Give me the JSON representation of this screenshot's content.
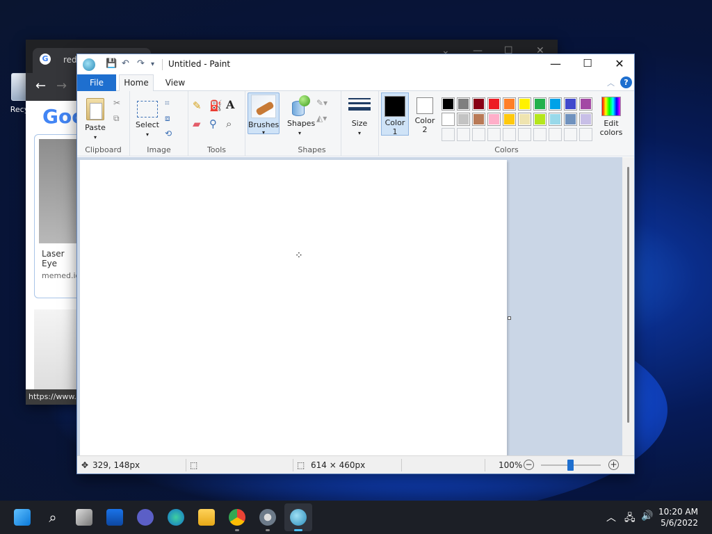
{
  "desktop": {
    "recycle_label": "Recyc"
  },
  "chrome": {
    "tab_title": "red ey",
    "google_text": "Goo",
    "card_title": "Laser Eye",
    "card_url": "memed.io",
    "status_url": "https://www."
  },
  "paint": {
    "title": "Untitled - Paint",
    "tabs": {
      "file": "File",
      "home": "Home",
      "view": "View"
    },
    "help": "?",
    "groups": {
      "clipboard": "Clipboard",
      "image": "Image",
      "tools": "Tools",
      "shapes": "Shapes",
      "colors": "Colors"
    },
    "buttons": {
      "paste": "Paste",
      "select": "Select",
      "brushes": "Brushes",
      "shapes": "Shapes",
      "size": "Size",
      "color1_a": "Color",
      "color1_b": "1",
      "color2_a": "Color",
      "color2_b": "2",
      "edit_colors_a": "Edit",
      "edit_colors_b": "colors"
    },
    "color1": "#000000",
    "color2": "#ffffff",
    "palette_row1": [
      "#000000",
      "#7f7f7f",
      "#880015",
      "#ed1c24",
      "#ff7f27",
      "#fff200",
      "#22b14c",
      "#00a2e8",
      "#3f48cc",
      "#a349a4"
    ],
    "palette_row2": [
      "#ffffff",
      "#c3c3c3",
      "#b97a57",
      "#ffaec9",
      "#ffc90e",
      "#efe4b0",
      "#b5e61d",
      "#99d9ea",
      "#7092be",
      "#c8bfe7"
    ],
    "status": {
      "cursor_pos": "329, 148px",
      "canvas_size": "614 × 460px",
      "zoom": "100%"
    }
  },
  "taskbar": {
    "time": "10:20 AM",
    "date": "5/6/2022"
  }
}
